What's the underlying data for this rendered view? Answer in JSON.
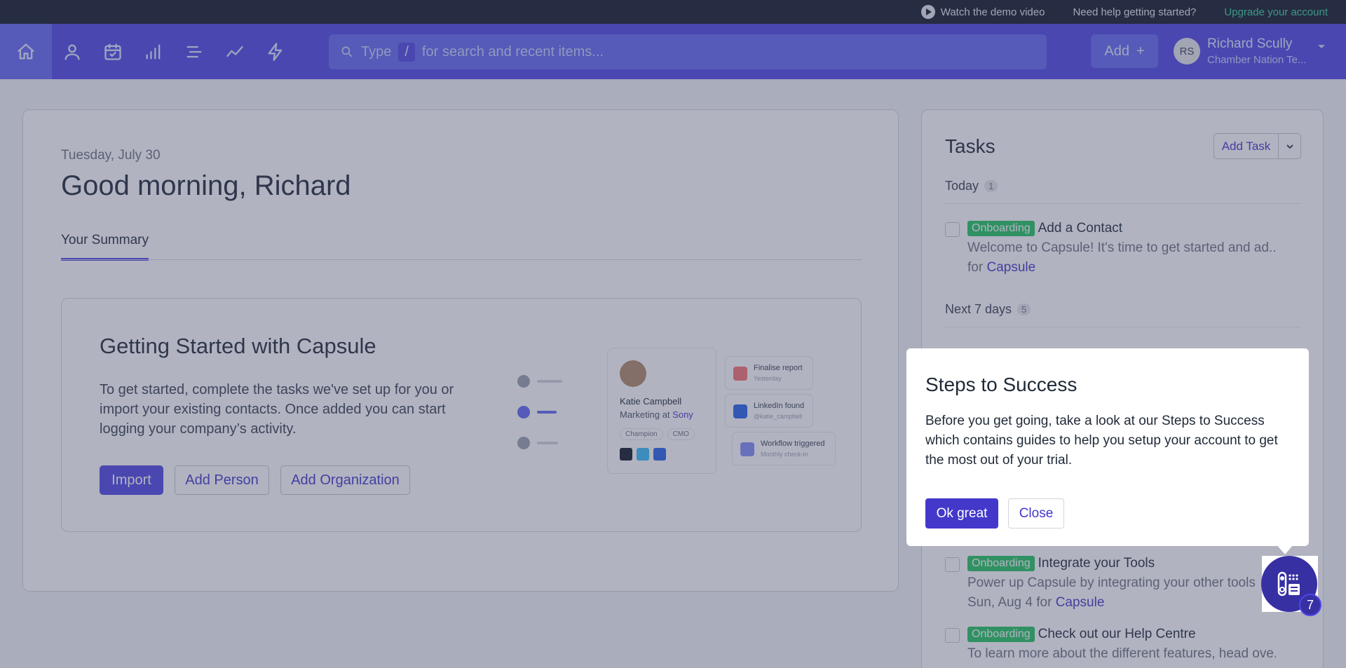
{
  "topstrip": {
    "demo_label": "Watch the demo video",
    "help_label": "Need help getting started?",
    "upgrade_label": "Upgrade your account"
  },
  "nav": {
    "icons": [
      "home-icon",
      "person-icon",
      "calendar-icon",
      "pipeline-icon",
      "list-icon",
      "trend-icon",
      "bolt-icon"
    ],
    "search": {
      "prefix": "Type",
      "key": "/",
      "suffix": "for search and recent items..."
    },
    "add_label": "Add",
    "user": {
      "initials": "RS",
      "name": "Richard Scully",
      "org": "Chamber Nation Te..."
    }
  },
  "main": {
    "date": "Tuesday, July 30",
    "greeting": "Good morning, Richard",
    "tab": "Your Summary",
    "getting_started": {
      "title": "Getting Started with Capsule",
      "text": "To get started, complete the tasks we've set up for you or import your existing contacts. Once added you can start logging your company’s activity.",
      "import_label": "Import",
      "add_person_label": "Add Person",
      "add_org_label": "Add Organization"
    },
    "illustration": {
      "contact_name": "Katie Campbell",
      "contact_role": "Marketing at",
      "contact_company": "Sony",
      "tags": [
        "Champion",
        "CMO"
      ],
      "notes": [
        {
          "title": "Finalise report",
          "sub": "Yesterday"
        },
        {
          "title": "LinkedIn found",
          "sub": "@katie_campbell"
        },
        {
          "title": "Workflow triggered",
          "sub": "Monthly check-in"
        }
      ]
    }
  },
  "tasks": {
    "title": "Tasks",
    "add_label": "Add Task",
    "today": {
      "label": "Today",
      "count": "1"
    },
    "next7": {
      "label": "Next 7 days",
      "count": "5"
    },
    "items": [
      {
        "badge": "Onboarding",
        "title": "Add a Contact",
        "desc": "Welcome to Capsule! It's time to get started and ad...",
        "meta_prefix": "for",
        "meta_link": "Capsule"
      },
      {
        "badge": "Onboarding",
        "title": "Integrate your Tools",
        "desc": "Power up Capsule by integrating your other tools",
        "meta_prefix": "Sun, Aug 4 for",
        "meta_link": "Capsule"
      },
      {
        "badge": "Onboarding",
        "title": "Check out our Help Centre",
        "desc": "To learn more about the different features, head ove..."
      }
    ]
  },
  "popover": {
    "title": "Steps to Success",
    "body": "Before you get going, take a look at our Steps to Success which contains guides to help you setup your account to get the most out of your trial.",
    "ok_label": "Ok great",
    "close_label": "Close"
  },
  "launcher": {
    "count": "7"
  },
  "colors": {
    "brand": "#4f46e5",
    "badge": "#22c55e",
    "topstrip": "#111827"
  }
}
